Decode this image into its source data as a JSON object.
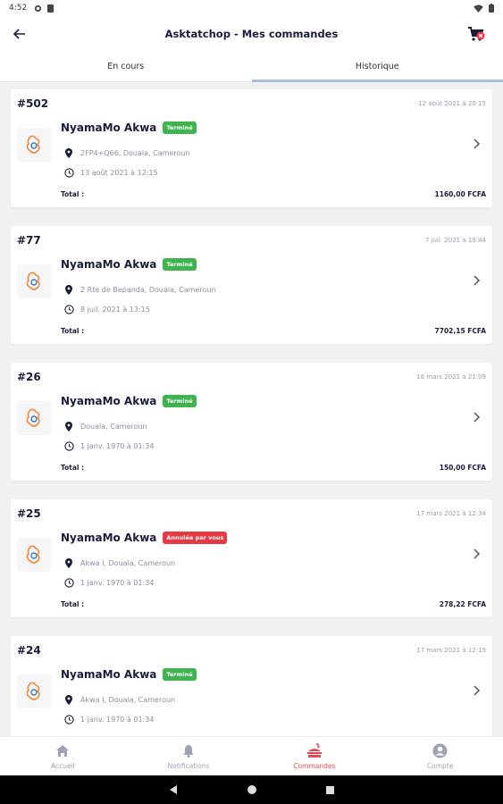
{
  "status_bar": {
    "time": "4:52"
  },
  "app_bar": {
    "title": "Asktatchop - Mes commandes"
  },
  "tabs": [
    {
      "label": "En cours",
      "active": false
    },
    {
      "label": "Historique",
      "active": true
    }
  ],
  "orders": [
    {
      "number": "#502",
      "date": "12 août 2021 à 20:15",
      "restaurant": "NyamaMo Akwa",
      "status": "Terminé",
      "status_type": "done",
      "address": "2FP4+Q66, Douala, Cameroun",
      "ordered_at": "13 août 2021 à 12:15",
      "total_label": "Total :",
      "total": "1160,00 FCFA"
    },
    {
      "number": "#77",
      "date": "7 juil. 2021 à 19:44",
      "restaurant": "NyamaMo Akwa",
      "status": "Terminé",
      "status_type": "done",
      "address": "2 Rte de Bepanda, Douala, Cameroun",
      "ordered_at": "8 juil. 2021 à 13:15",
      "total_label": "Total :",
      "total": "7702,15 FCFA"
    },
    {
      "number": "#26",
      "date": "16 mars 2021 à 21:09",
      "restaurant": "NyamaMo Akwa",
      "status": "Terminé",
      "status_type": "done",
      "address": "Douala, Cameroun",
      "ordered_at": "1 janv. 1970 à 01:34",
      "total_label": "Total :",
      "total": "150,00 FCFA"
    },
    {
      "number": "#25",
      "date": "17 mars 2021 à 12:34",
      "restaurant": "NyamaMo Akwa",
      "status": "Annulée par vous",
      "status_type": "cancel",
      "address": "Akwa I, Douala, Cameroun",
      "ordered_at": "1 janv. 1970 à 01:34",
      "total_label": "Total :",
      "total": "278,22 FCFA"
    },
    {
      "number": "#24",
      "date": "17 mars 2021 à 12:19",
      "restaurant": "NyamaMo Akwa",
      "status": "Terminé",
      "status_type": "done",
      "address": "Akwa I, Douala, Cameroun",
      "ordered_at": "1 janv. 1970 à 01:34",
      "total_label": "",
      "total": ""
    }
  ],
  "bottom_nav": [
    {
      "label": "Accueil",
      "icon": "home-icon",
      "active": false
    },
    {
      "label": "Notifications",
      "icon": "bell-icon",
      "active": false
    },
    {
      "label": "Commandes",
      "icon": "orders-icon",
      "active": true
    },
    {
      "label": "Compte",
      "icon": "account-icon",
      "active": false
    }
  ],
  "colors": {
    "accent": "#e04b58",
    "done": "#3fb34f",
    "cancel": "#e53945",
    "tab_indicator": "#a9bde6",
    "text": "#1a1d3a"
  }
}
